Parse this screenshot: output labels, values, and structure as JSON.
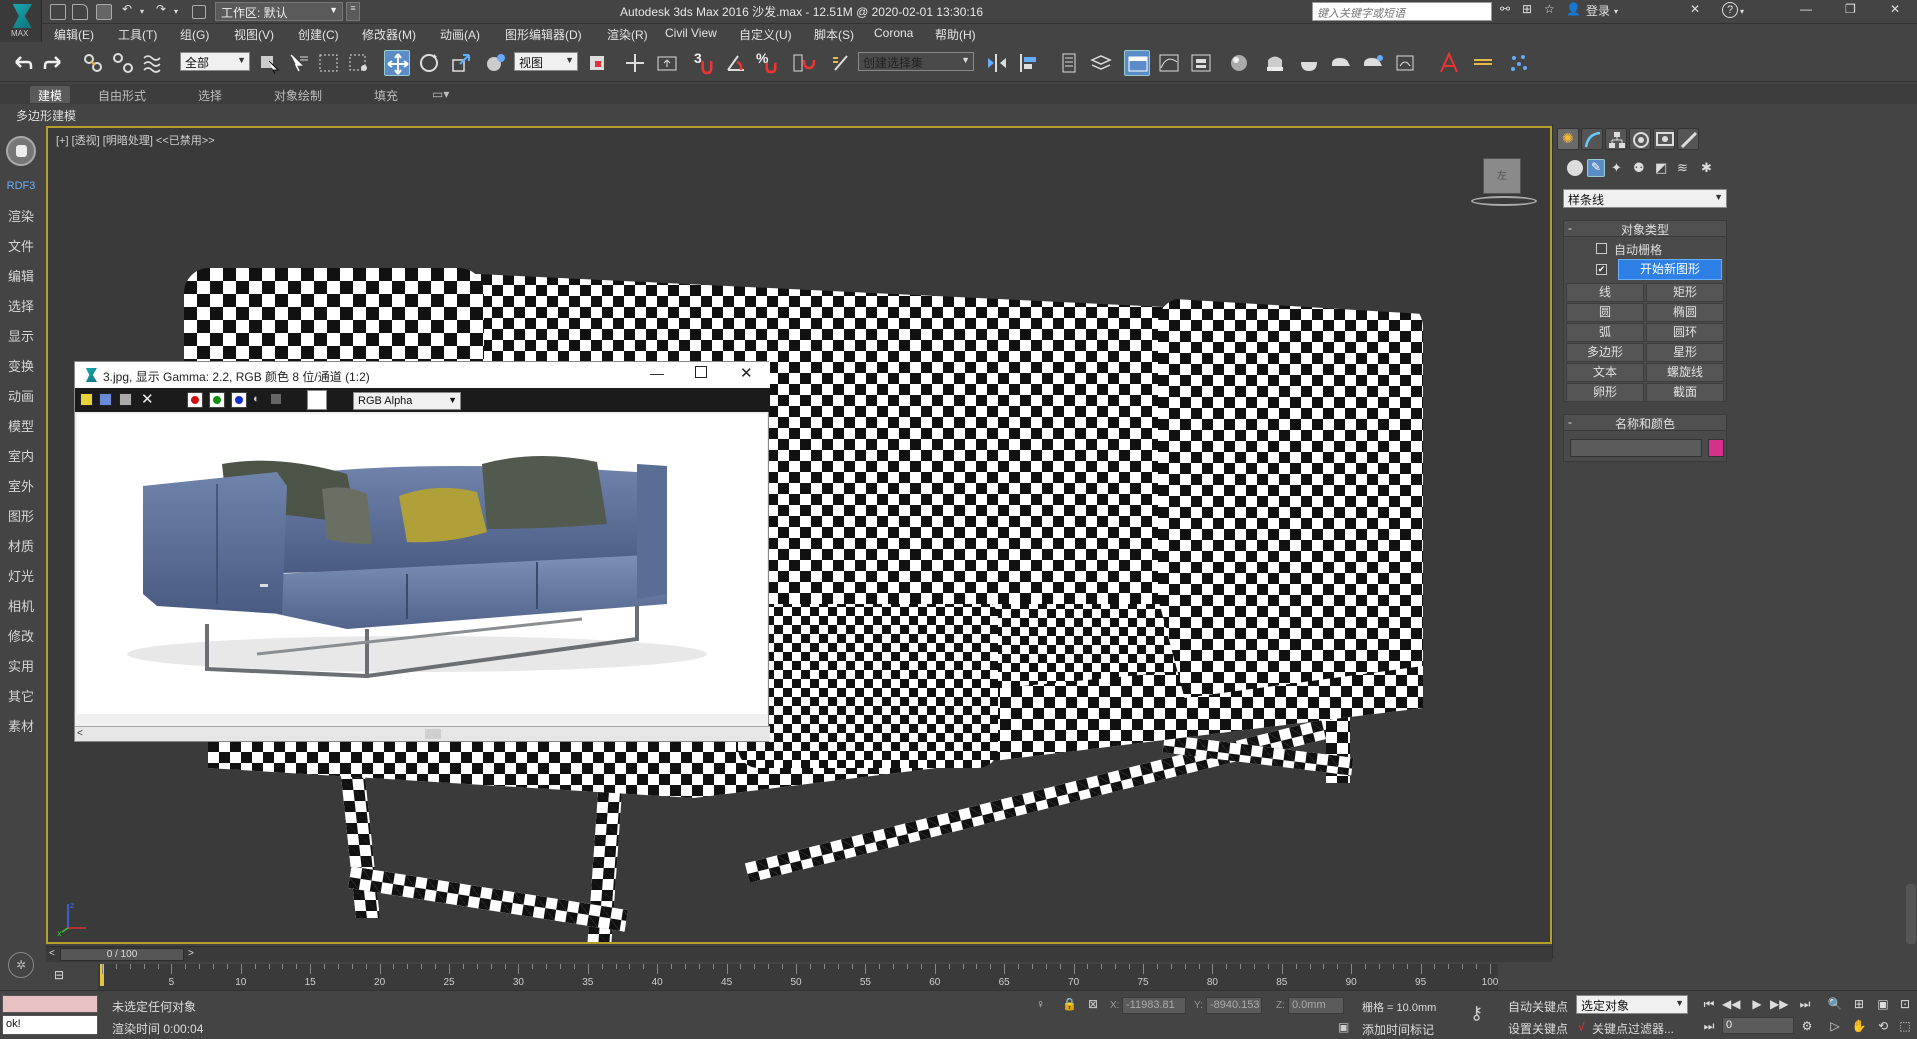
{
  "app": {
    "window_title": "Autodesk 3ds Max 2016    沙发.max - 12.51M @ 2020-02-01 13:30:16",
    "logo_text": "MAX",
    "workspace": "工作区: 默认",
    "search_placeholder": "键入关键字或短语",
    "login": "登录"
  },
  "menu": [
    "编辑(E)",
    "工具(T)",
    "组(G)",
    "视图(V)",
    "创建(C)",
    "修改器(M)",
    "动画(A)",
    "图形编辑器(D)",
    "渲染(R)",
    "Civil View",
    "自定义(U)",
    "脚本(S)",
    "Corona",
    "帮助(H)"
  ],
  "toolbar": {
    "selection_filter": "全部",
    "ref_coord": "视图",
    "named_selection": "创建选择集",
    "snap_labels": [
      "3",
      "%"
    ]
  },
  "ribbon": {
    "tabs": [
      "建模",
      "自由形式",
      "选择",
      "对象绘制",
      "填充"
    ],
    "active_tab": "建模",
    "sub_label": "多边形建模"
  },
  "leftbar": {
    "brand": "RDF3",
    "items": [
      "渲染",
      "文件",
      "编辑",
      "选择",
      "显示",
      "变换",
      "动画",
      "模型",
      "室内",
      "室外",
      "图形",
      "材质",
      "灯光",
      "相机",
      "修改",
      "实用",
      "其它",
      "素材"
    ]
  },
  "viewport": {
    "label": "[+] [透视] [明暗处理] <<已禁用>>",
    "viewcube_label": "左"
  },
  "frame_window": {
    "title": "3.jpg, 显示 Gamma: 2.2, RGB 颜色 8 位/通道 (1:2)",
    "channel": "RGB Alpha",
    "colors": {
      "red": "#d01010",
      "green": "#109010",
      "blue": "#1030d0"
    }
  },
  "command_panel": {
    "category": "样条线",
    "object_type_title": "对象类型",
    "auto_grid": "自动栅格",
    "start_new_shape": "开始新图形",
    "buttons": [
      "线",
      "矩形",
      "圆",
      "椭圆",
      "弧",
      "圆环",
      "多边形",
      "星形",
      "文本",
      "螺旋线",
      "卵形",
      "截面"
    ],
    "name_color_title": "名称和颜色",
    "object_color": "#d6308a"
  },
  "timeline": {
    "frame_counter": "0 / 100",
    "ticks": [
      5,
      10,
      15,
      20,
      25,
      30,
      35,
      40,
      45,
      50,
      55,
      60,
      65,
      70,
      75,
      80,
      85,
      90,
      95,
      100
    ]
  },
  "status": {
    "prompt_1": "未选定任何对象",
    "prompt_2": "渲染时间  0:00:04",
    "maxscript": "ok!",
    "x_label": "X:",
    "x_value": "-11983.81",
    "y_label": "Y:",
    "y_value": "-8940.153",
    "z_label": "Z:",
    "z_value": "0.0mm",
    "grid": "栅格 = 10.0mm",
    "add_time_tag": "添加时间标记",
    "auto_key": "自动关键点",
    "set_key": "设置关键点",
    "selected_object": "选定对象",
    "key_filters": "关键点过滤器...",
    "current_frame": "0"
  }
}
